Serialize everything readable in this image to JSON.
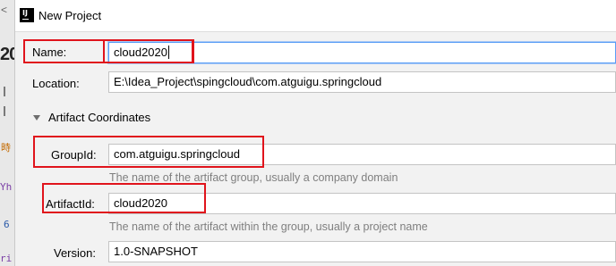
{
  "window": {
    "title": "New Project",
    "icon": "intellij-app-icon"
  },
  "background": {
    "heading_fragment": "20",
    "chevron": "<"
  },
  "form": {
    "name": {
      "label": "Name:",
      "value": "cloud2020"
    },
    "location": {
      "label": "Location:",
      "value": "E:\\Idea_Project\\spingcloud\\com.atguigu.springcloud"
    },
    "artifact_section": {
      "label": "Artifact Coordinates",
      "expanded": true
    },
    "group_id": {
      "label": "GroupId:",
      "value": "com.atguigu.springcloud",
      "hint": "The name of the artifact group, usually a company domain"
    },
    "artifact_id": {
      "label": "ArtifactId:",
      "value": "cloud2020",
      "hint": "The name of the artifact within the group, usually a project name"
    },
    "version": {
      "label": "Version:",
      "value": "1.0-SNAPSHOT"
    }
  },
  "colors": {
    "highlight": "#e0141c",
    "focus": "#589df6",
    "hint_text": "#7f7f7f"
  }
}
